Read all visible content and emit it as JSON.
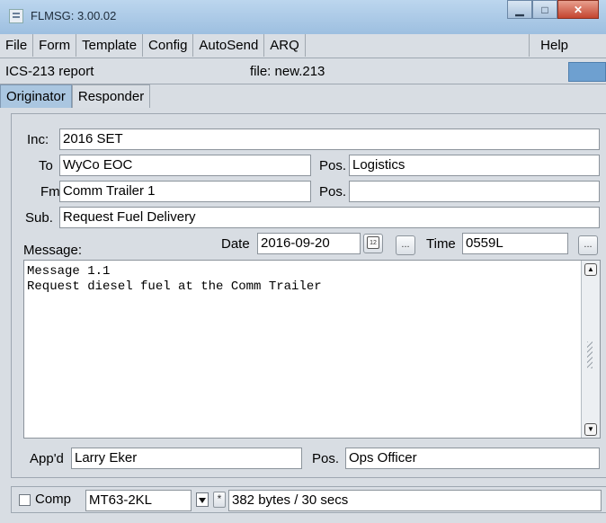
{
  "window": {
    "title": "FLMSG: 3.00.02"
  },
  "menu": {
    "items": [
      "File",
      "Form",
      "Template",
      "Config",
      "AutoSend",
      "ARQ"
    ],
    "help": "Help"
  },
  "status": {
    "form_name": "ICS-213 report",
    "file": "file: new.213"
  },
  "tabs": [
    "Originator",
    "Responder"
  ],
  "form": {
    "inc_label": "Inc:",
    "inc_value": "2016 SET",
    "to_label": "To",
    "to_value": "WyCo EOC",
    "to_pos_label": "Pos.",
    "to_pos_value": "Logistics",
    "fm_label": "Fm",
    "fm_value": "Comm Trailer 1",
    "fm_pos_label": "Pos.",
    "fm_pos_value": "",
    "sub_label": "Sub.",
    "sub_value": "Request Fuel Delivery",
    "message_label": "Message:",
    "date_label": "Date",
    "date_value": "2016-09-20",
    "calendar_icon_text": "12",
    "date_more": "...",
    "time_label": "Time",
    "time_value": "0559L",
    "time_more": "...",
    "message_text": "Message 1.1\nRequest diesel fuel at the Comm Trailer",
    "appd_label": "App'd",
    "appd_value": "Larry Eker",
    "appd_pos_label": "Pos.",
    "appd_pos_value": "Ops Officer"
  },
  "bottom": {
    "comp_label": "Comp",
    "comp_checked": false,
    "mode_value": "MT63-2KL",
    "star_button": "*",
    "size_info": "382 bytes / 30 secs"
  },
  "icons": {
    "app": "flmsg-app-icon",
    "minimize": "minimize-icon",
    "maximize": "maximize-icon",
    "close": "close-icon",
    "calendar": "calendar-icon",
    "dropdown": "chevron-down-icon"
  },
  "colors": {
    "title_bar": "#9dbfe0",
    "active_tab": "#aac6e0",
    "close_button": "#c4452f"
  }
}
